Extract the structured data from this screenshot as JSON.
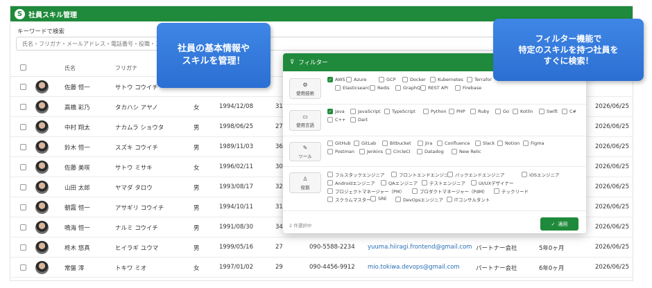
{
  "app": {
    "logo_letter": "S",
    "title": "社員スキル管理"
  },
  "search": {
    "label": "キーワードで検索",
    "placeholder": "氏名・フリガナ・メールアドレス・電話番号・役職・ス"
  },
  "table": {
    "headers": {
      "name": "氏名",
      "kana": "フリガナ"
    },
    "rows": [
      {
        "name": "佐藤 恒一",
        "kana": "サトウ コウイチ",
        "gender": "",
        "birth": "",
        "age": "",
        "phone": "",
        "email": "",
        "company": "",
        "tenure": "",
        "date": ""
      },
      {
        "name": "高橋 彩乃",
        "kana": "タカハシ アヤノ",
        "gender": "女",
        "birth": "1994/12/08",
        "age": "31",
        "phone": "",
        "email": "",
        "company": "",
        "tenure": "",
        "date": "2026/06/25"
      },
      {
        "name": "中村 翔太",
        "kana": "ナカムラ ショウタ",
        "gender": "男",
        "birth": "1998/06/25",
        "age": "27",
        "phone": "",
        "email": "",
        "company": "",
        "tenure": "",
        "date": "2026/06/25"
      },
      {
        "name": "鈴木 恒一",
        "kana": "スズキ コウイチ",
        "gender": "男",
        "birth": "1989/11/03",
        "age": "36",
        "phone": "",
        "email": "",
        "company": "",
        "tenure": "",
        "date": "2026/06/25"
      },
      {
        "name": "佐藤 美咲",
        "kana": "サトウ ミサキ",
        "gender": "女",
        "birth": "1996/02/11",
        "age": "30",
        "phone": "",
        "email": "",
        "company": "",
        "tenure": "",
        "date": "2026/06/25"
      },
      {
        "name": "山田 太郎",
        "kana": "ヤマダ タロウ",
        "gender": "男",
        "birth": "1993/08/17",
        "age": "32",
        "phone": "",
        "email": "",
        "company": "",
        "tenure": "",
        "date": "2026/06/25"
      },
      {
        "name": "朝霧 恒一",
        "kana": "アサギリ コウイチ",
        "gender": "男",
        "birth": "1994/10/11",
        "age": "31",
        "phone": "",
        "email": "",
        "company": "",
        "tenure": "",
        "date": "2026/06/25"
      },
      {
        "name": "鳴海 恒一",
        "kana": "ナルミ コウイチ",
        "gender": "男",
        "birth": "1991/08/30",
        "age": "34",
        "phone": "",
        "email": "",
        "company": "",
        "tenure": "",
        "date": "2026/06/25"
      },
      {
        "name": "柊木 悠真",
        "kana": "ヒイラギ ユウマ",
        "gender": "男",
        "birth": "1999/05/16",
        "age": "27",
        "phone": "090-5588-2234",
        "email": "yuuma.hiiragi.frontend@gmail.com",
        "company": "パートナー会社",
        "tenure": "5年0ヶ月",
        "date": "2026/06/25"
      },
      {
        "name": "常盤 澪",
        "kana": "トキワ ミオ",
        "gender": "女",
        "birth": "1997/01/02",
        "age": "29",
        "phone": "090-4456-9912",
        "email": "mio.tokiwa.devops@gmail.com",
        "company": "パートナー会社",
        "tenure": "6年0ヶ月",
        "date": "2026/06/25"
      }
    ]
  },
  "callouts": {
    "left": [
      "社員の基本情報や",
      "スキルを管理！"
    ],
    "right": [
      "フィルター機能で",
      "特定のスキルを持つ社員を",
      "すぐに検索！"
    ]
  },
  "filter": {
    "title": "フィルター",
    "sections": [
      {
        "label": "使用技術",
        "icon": "⚙",
        "options": [
          {
            "text": "AWS",
            "checked": true
          },
          {
            "text": "Azure",
            "checked": false
          },
          {
            "text": "GCP",
            "checked": false
          },
          {
            "text": "Docker",
            "checked": false
          },
          {
            "text": "Kubernetes",
            "checked": false
          },
          {
            "text": "Terrafor",
            "checked": false
          },
          {
            "text": "Elasticsearch",
            "checked": false
          },
          {
            "text": "Redis",
            "checked": false
          },
          {
            "text": "GraphQL",
            "checked": false
          },
          {
            "text": "REST API",
            "checked": false
          },
          {
            "text": "Firebase",
            "checked": false
          }
        ]
      },
      {
        "label": "使用言語",
        "icon": "▭",
        "options": [
          {
            "text": "Java",
            "checked": true
          },
          {
            "text": "JavaScript",
            "checked": false
          },
          {
            "text": "TypeScript",
            "checked": false
          },
          {
            "text": "Python",
            "checked": false
          },
          {
            "text": "PHP",
            "checked": false
          },
          {
            "text": "Ruby",
            "checked": false
          },
          {
            "text": "Go",
            "checked": false
          },
          {
            "text": "Kotlin",
            "checked": false
          },
          {
            "text": "Swift",
            "checked": false
          },
          {
            "text": "C#",
            "checked": false
          },
          {
            "text": "C++",
            "checked": false
          },
          {
            "text": "Dart",
            "checked": false
          }
        ]
      },
      {
        "label": "ツール",
        "icon": "✎",
        "options": [
          {
            "text": "GitHub",
            "checked": false
          },
          {
            "text": "GitLab",
            "checked": false
          },
          {
            "text": "Bitbucket",
            "checked": false
          },
          {
            "text": "Jira",
            "checked": false
          },
          {
            "text": "Confluence",
            "checked": false
          },
          {
            "text": "Slack",
            "checked": false
          },
          {
            "text": "Notion",
            "checked": false
          },
          {
            "text": "Figma",
            "checked": false
          },
          {
            "text": "Postman",
            "checked": false
          },
          {
            "text": "Jenkins",
            "checked": false
          },
          {
            "text": "CircleCI",
            "checked": false
          },
          {
            "text": "Datadog",
            "checked": false
          },
          {
            "text": "New Relic",
            "checked": false
          }
        ]
      },
      {
        "label": "役割",
        "icon": "♙",
        "options": [
          {
            "text": "フルスタックエンジニア",
            "checked": false
          },
          {
            "text": "フロントエンドエンジニア",
            "checked": false
          },
          {
            "text": "バックエンドエンジニア",
            "checked": false
          },
          {
            "text": "iOSエンジニア",
            "checked": false
          },
          {
            "text": "Androidエンジニア",
            "checked": false
          },
          {
            "text": "QAエンジニア",
            "checked": false
          },
          {
            "text": "テストエンジニア",
            "checked": false
          },
          {
            "text": "UI/UXデザイナー",
            "checked": false
          },
          {
            "text": "プロジェクトマネージャー（PM）",
            "checked": false
          },
          {
            "text": "プロダクトマネージャー（PdM）",
            "checked": false
          },
          {
            "text": "テックリード",
            "checked": false
          },
          {
            "text": "スクラムマスター",
            "checked": false
          },
          {
            "text": "SRE",
            "checked": false
          },
          {
            "text": "DevOpsエンジニア",
            "checked": false
          },
          {
            "text": "ITコンサルタント",
            "checked": false
          }
        ]
      }
    ],
    "selected_count": "2 件選択中",
    "apply_label": "適用",
    "apply_icon": "✓"
  }
}
